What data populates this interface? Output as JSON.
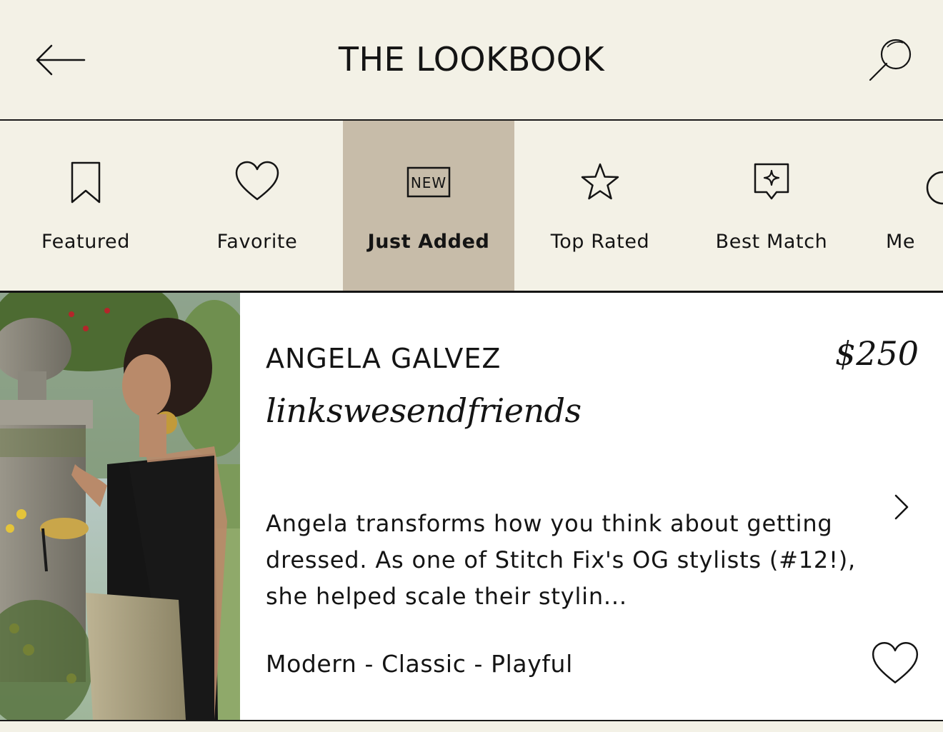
{
  "header": {
    "title": "THE LOOKBOOK",
    "back_icon": "arrow-left-icon",
    "search_icon": "search-icon"
  },
  "tabs": [
    {
      "label": "Featured",
      "icon": "bookmark-icon",
      "active": false
    },
    {
      "label": "Favorite",
      "icon": "heart-icon",
      "active": false
    },
    {
      "label": "Just Added",
      "icon": "new-badge-icon",
      "active": true
    },
    {
      "label": "Top Rated",
      "icon": "star-icon",
      "active": false
    },
    {
      "label": "Best Match",
      "icon": "sparkle-badge-icon",
      "active": false
    },
    {
      "label": "Me",
      "icon": "circle-icon",
      "active": false
    }
  ],
  "new_badge_text": "NEW",
  "stylist": {
    "name": "ANGELA GALVEZ",
    "price": "$250",
    "handle": "linkswesendfriends",
    "description": "Angela transforms how you think about getting dressed. As one of Stitch Fix's OG stylists (#12!), she helped scale their stylin...",
    "tags": "Modern - Classic - Playful",
    "photo": "stylist-photo",
    "chevron_icon": "chevron-right-icon",
    "favorite_icon": "heart-outline-icon"
  },
  "colors": {
    "background": "#f3f1e6",
    "active_tab": "#c7bca9",
    "text": "#141414",
    "card": "#ffffff"
  }
}
